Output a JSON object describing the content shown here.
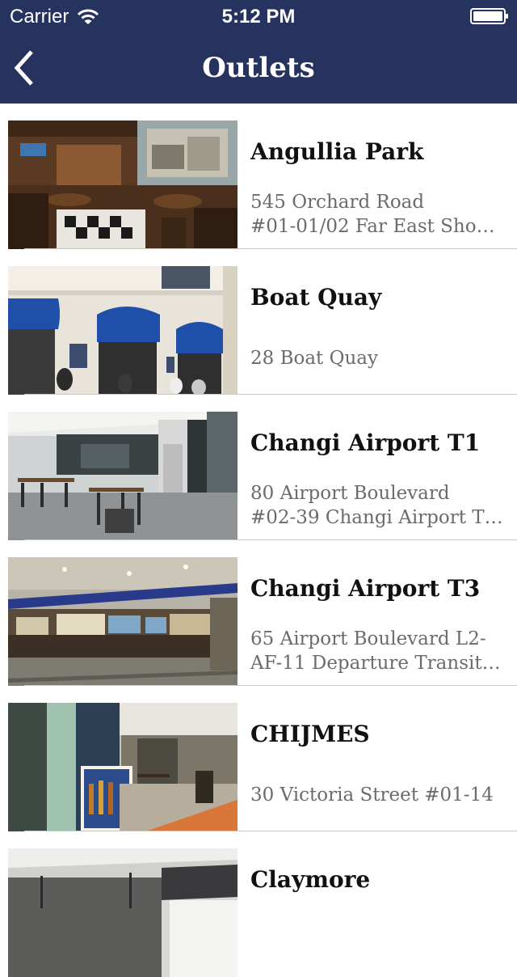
{
  "status_bar": {
    "carrier": "Carrier",
    "time": "5:12 PM"
  },
  "nav": {
    "title": "Outlets",
    "back_icon": "chevron-left-icon"
  },
  "colors": {
    "nav_background": "#27335f",
    "title_text": "#111111",
    "address_text": "#6b6b6b",
    "separator": "#c8c7cc"
  },
  "outlets": [
    {
      "name": "Angullia Park",
      "address_lines": [
        "545 Orchard Road",
        "#01-01/02 Far East Shop…"
      ]
    },
    {
      "name": "Boat Quay",
      "address_lines": [
        "28 Boat Quay"
      ]
    },
    {
      "name": "Changi Airport T1",
      "address_lines": [
        "80 Airport Boulevard",
        "#02-39 Changi Airport T…"
      ]
    },
    {
      "name": "Changi Airport T3",
      "address_lines": [
        "65 Airport Boulevard L2-",
        "AF-11 Departure Transit…"
      ]
    },
    {
      "name": "CHIJMES",
      "address_lines": [
        "30 Victoria Street #01-14"
      ]
    },
    {
      "name": "Claymore",
      "address_lines": []
    }
  ]
}
